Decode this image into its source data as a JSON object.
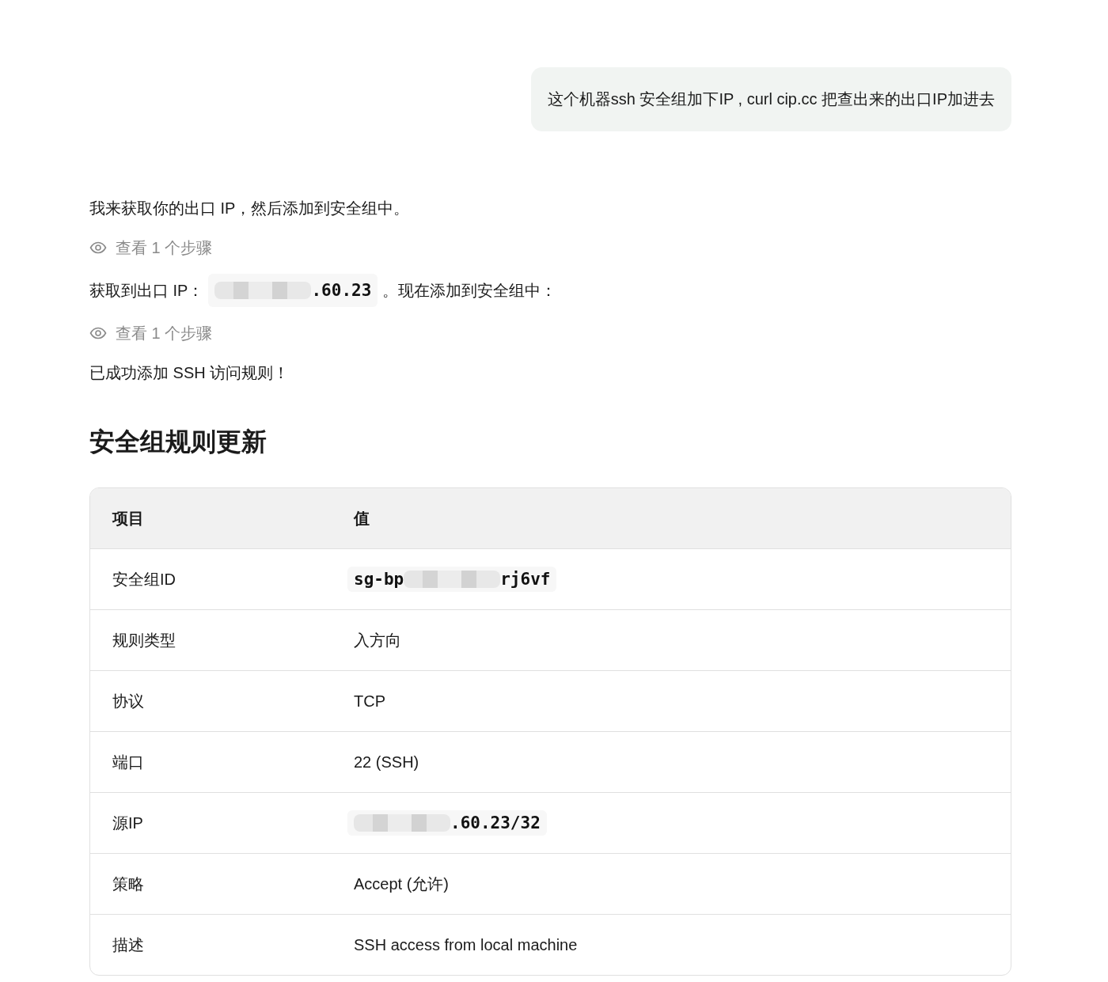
{
  "user_message": "这个机器ssh 安全组加下IP , curl cip.cc 把查出来的出口IP加进去",
  "assistant": [
    {
      "kind": "text",
      "parts": [
        {
          "text": "我来获取你的出口 IP，然后添加到安全组中。"
        }
      ]
    },
    {
      "kind": "steps",
      "label": "查看 1 个步骤"
    },
    {
      "kind": "text",
      "parts": [
        {
          "text": "获取到出口 IP："
        },
        {
          "code": {
            "redacted": true,
            "after": ".60.23"
          }
        },
        {
          "text": "。现在添加到安全组中："
        }
      ]
    },
    {
      "kind": "steps",
      "label": "查看 1 个步骤"
    },
    {
      "kind": "text",
      "parts": [
        {
          "text": "已成功添加 SSH 访问规则！"
        }
      ]
    },
    {
      "kind": "heading",
      "text": "安全组规则更新"
    },
    {
      "kind": "table",
      "columns": [
        "项目",
        "值"
      ],
      "rows": [
        [
          "安全组ID",
          {
            "code": {
              "before": "sg-bp",
              "redacted": true,
              "after": "rj6vf"
            }
          }
        ],
        [
          "规则类型",
          "入方向"
        ],
        [
          "协议",
          "TCP"
        ],
        [
          "端口",
          "22 (SSH)"
        ],
        [
          "源IP",
          {
            "code": {
              "redacted": true,
              "after": ".60.23/32"
            }
          }
        ],
        [
          "策略",
          "Accept (允许)"
        ],
        [
          "描述",
          "SSH access from local machine"
        ]
      ]
    }
  ]
}
